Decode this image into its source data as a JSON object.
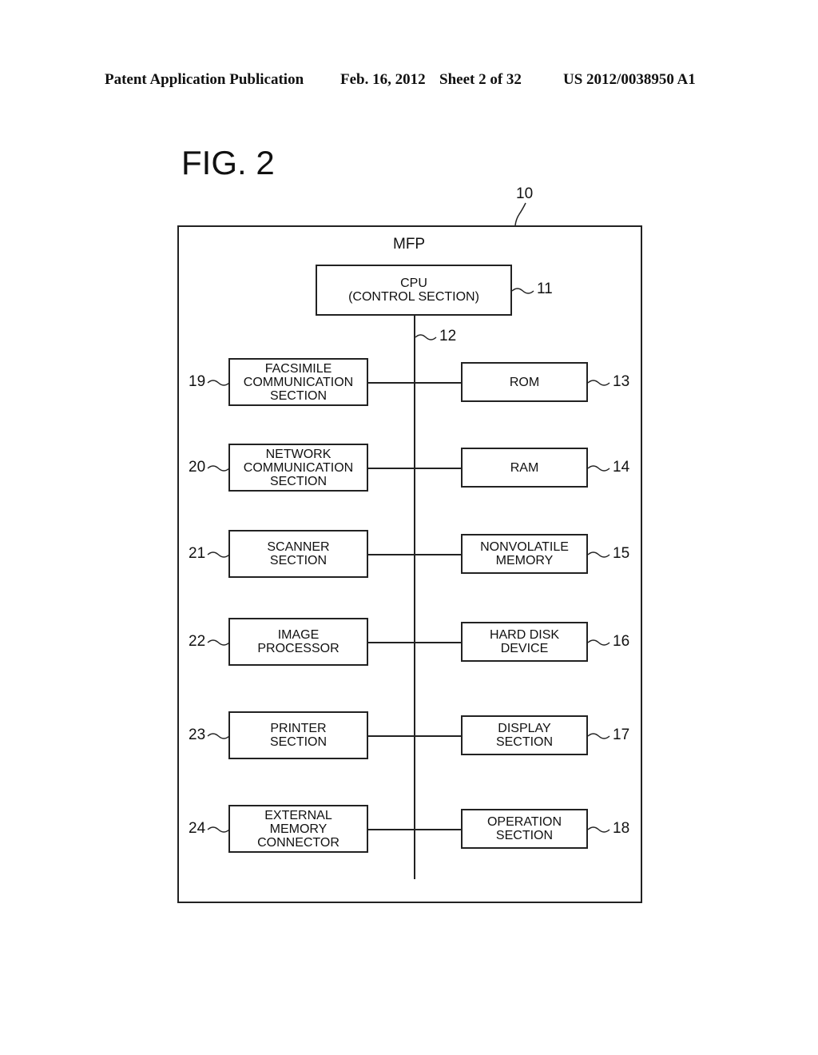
{
  "header": {
    "left": "Patent Application Publication",
    "date": "Feb. 16, 2012",
    "sheet": "Sheet 2 of 32",
    "number": "US 2012/0038950 A1"
  },
  "figure": {
    "title": "FIG. 2",
    "outer_ref": "10",
    "outer_label": "MFP",
    "bus_ref": "12",
    "cpu": {
      "label": "CPU\n(CONTROL SECTION)",
      "ref": "11"
    },
    "left_blocks": [
      {
        "label": "FACSIMILE\nCOMMUNICATION\nSECTION",
        "ref": "19"
      },
      {
        "label": "NETWORK\nCOMMUNICATION\nSECTION",
        "ref": "20"
      },
      {
        "label": "SCANNER\nSECTION",
        "ref": "21"
      },
      {
        "label": "IMAGE\nPROCESSOR",
        "ref": "22"
      },
      {
        "label": "PRINTER\nSECTION",
        "ref": "23"
      },
      {
        "label": "EXTERNAL\nMEMORY\nCONNECTOR",
        "ref": "24"
      }
    ],
    "right_blocks": [
      {
        "label": "ROM",
        "ref": "13"
      },
      {
        "label": "RAM",
        "ref": "14"
      },
      {
        "label": "NONVOLATILE\nMEMORY",
        "ref": "15"
      },
      {
        "label": "HARD DISK\nDEVICE",
        "ref": "16"
      },
      {
        "label": "DISPLAY\nSECTION",
        "ref": "17"
      },
      {
        "label": "OPERATION\nSECTION",
        "ref": "18"
      }
    ]
  }
}
